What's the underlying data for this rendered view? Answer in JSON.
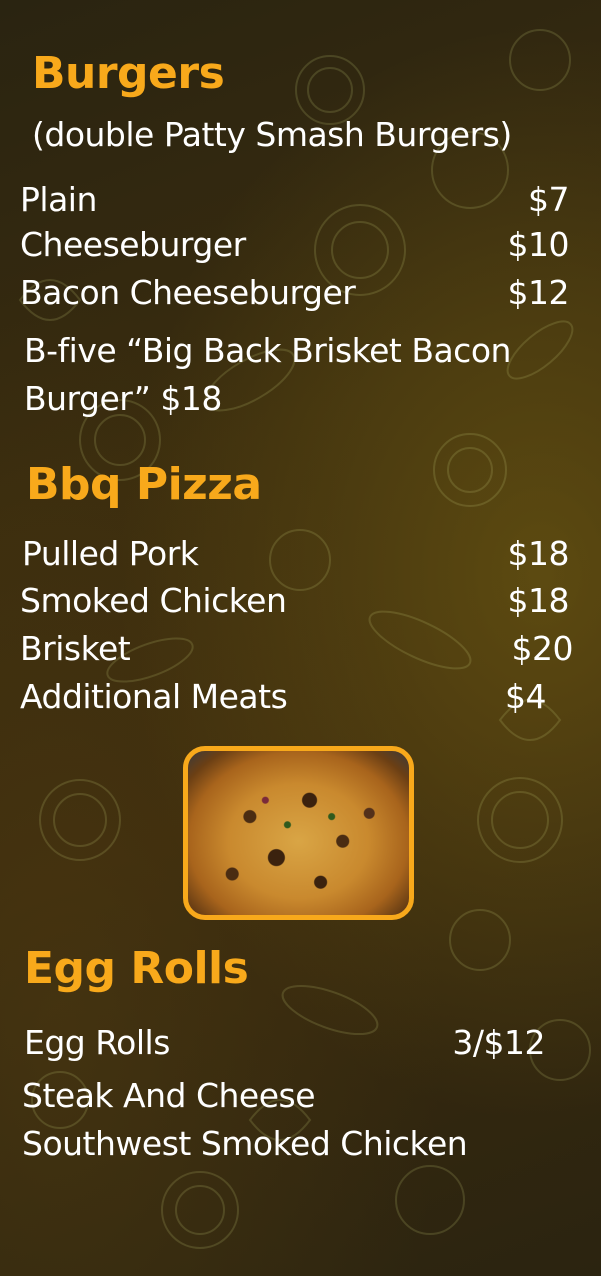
{
  "burgers": {
    "title": "Burgers",
    "subtitle": "(double Patty Smash Burgers)",
    "items": [
      {
        "name": "Plain",
        "price": "$7"
      },
      {
        "name": "Cheeseburger",
        "price": "$10"
      },
      {
        "name": "Bacon Cheeseburger",
        "price": "$12"
      }
    ],
    "special_line1": "B-five “Big Back Brisket Bacon",
    "special_line2": "Burger” $18"
  },
  "pizza": {
    "title": "Bbq Pizza",
    "items": [
      {
        "name": "Pulled Pork",
        "price": "$18"
      },
      {
        "name": "Smoked Chicken",
        "price": "$18"
      },
      {
        "name": "Brisket",
        "price": "$20"
      },
      {
        "name": "Additional Meats",
        "price": "$4"
      }
    ],
    "photo_icon": "pizza-photo"
  },
  "egg_rolls": {
    "title": "Egg Rolls",
    "items": [
      {
        "name": "Egg Rolls",
        "price": "3/$12"
      },
      {
        "name": "Steak And Cheese"
      },
      {
        "name": "Southwest Smoked Chicken"
      }
    ]
  },
  "colors": {
    "accent": "#f8a91b",
    "text": "#ffffff",
    "background": "#2e2610"
  }
}
